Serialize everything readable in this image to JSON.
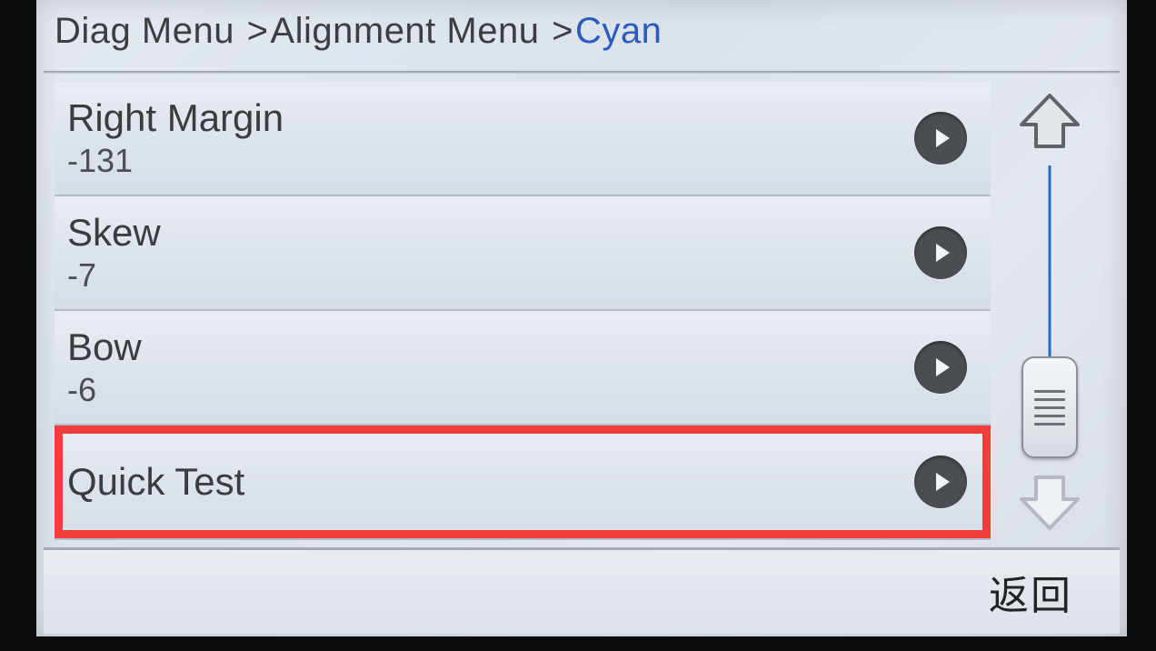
{
  "breadcrumb": {
    "part0": "Diag Menu",
    "part1": "Alignment Menu",
    "current": "Cyan",
    "sep": ">"
  },
  "items": [
    {
      "title": "Right Margin",
      "value": "-131"
    },
    {
      "title": "Skew",
      "value": "-7"
    },
    {
      "title": "Bow",
      "value": "-6"
    },
    {
      "title": "Quick Test",
      "value": ""
    }
  ],
  "footer": {
    "back_label": "返回"
  },
  "icons": {
    "right_arrow": "right-arrow-icon",
    "up": "scroll-up-icon",
    "down": "scroll-down-icon"
  },
  "colors": {
    "breadcrumb_current": "#2a5bbe",
    "highlight_box": "#f23d3d"
  }
}
